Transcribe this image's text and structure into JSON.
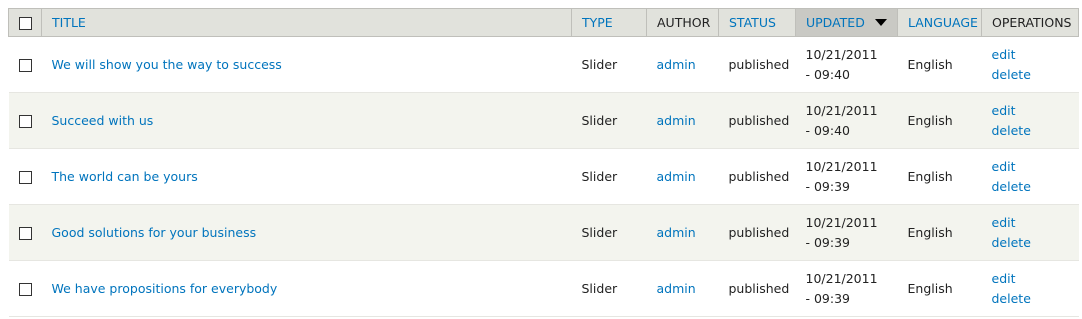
{
  "table": {
    "headers": {
      "title": "Title",
      "type": "Type",
      "author": "Author",
      "status": "Status",
      "updated": "Updated",
      "language": "Language",
      "operations": "Operations"
    },
    "sorted_column": "updated",
    "sort_direction": "descending",
    "rows": [
      {
        "title": "We will show you the way to success",
        "type": "Slider",
        "author": "admin",
        "status": "published",
        "updated_date": "10/21/2011",
        "updated_time": "- 09:40",
        "language": "English",
        "edit": "edit",
        "delete": "delete"
      },
      {
        "title": "Succeed with us",
        "type": "Slider",
        "author": "admin",
        "status": "published",
        "updated_date": "10/21/2011",
        "updated_time": "- 09:40",
        "language": "English",
        "edit": "edit",
        "delete": "delete"
      },
      {
        "title": "The world can be yours",
        "type": "Slider",
        "author": "admin",
        "status": "published",
        "updated_date": "10/21/2011",
        "updated_time": "- 09:39",
        "language": "English",
        "edit": "edit",
        "delete": "delete"
      },
      {
        "title": "Good solutions for your business",
        "type": "Slider",
        "author": "admin",
        "status": "published",
        "updated_date": "10/21/2011",
        "updated_time": "- 09:39",
        "language": "English",
        "edit": "edit",
        "delete": "delete"
      },
      {
        "title": "We have propositions for everybody",
        "type": "Slider",
        "author": "admin",
        "status": "published",
        "updated_date": "10/21/2011",
        "updated_time": "- 09:39",
        "language": "English",
        "edit": "edit",
        "delete": "delete"
      }
    ]
  },
  "colors": {
    "link": "#0074bd",
    "header_bg": "#e1e2dc",
    "active_header_bg": "#c9c9c4",
    "even_row_bg": "#f3f4ee"
  },
  "icons": {
    "sort": "triangle-down-icon",
    "checkbox": "checkbox-icon"
  }
}
